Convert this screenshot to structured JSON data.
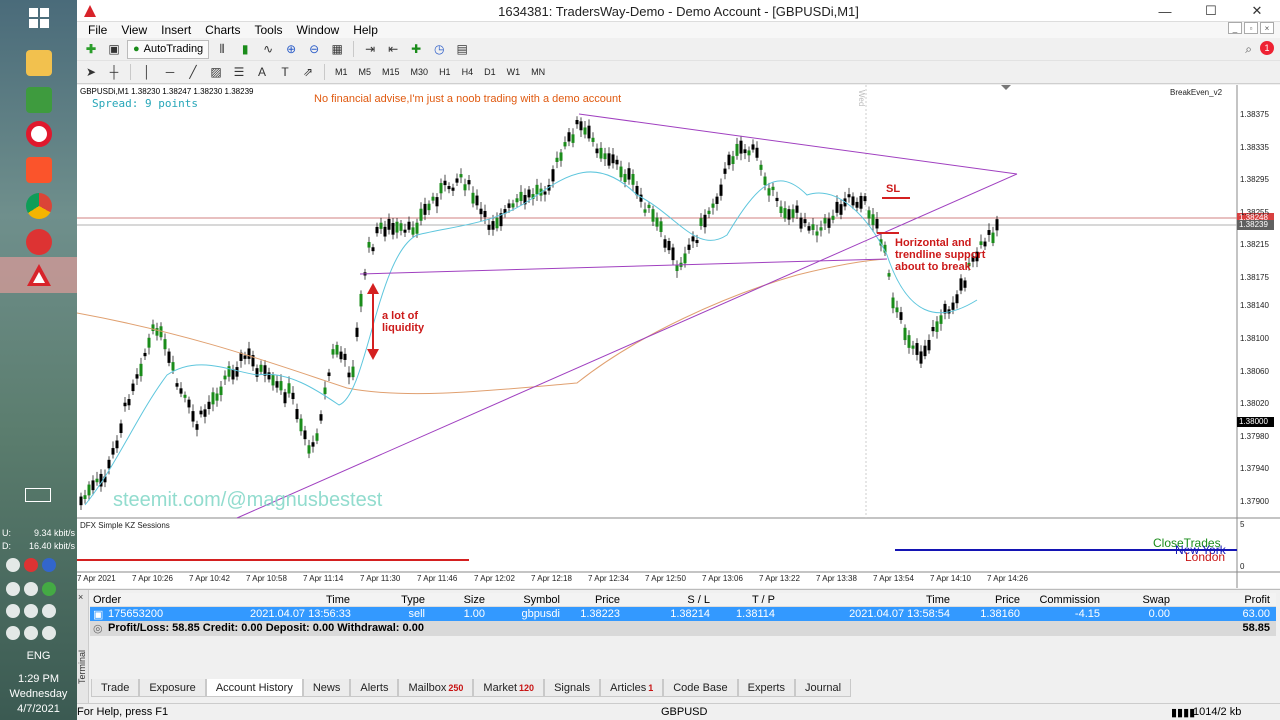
{
  "taskbar": {
    "net_upload": "9.34 kbit/s",
    "net_download": "16.40 kbit/s",
    "net_u": "U:",
    "net_d": "D:",
    "language": "ENG",
    "time": "1:29 PM",
    "day": "Wednesday",
    "date": "4/7/2021"
  },
  "window": {
    "title": "1634381: TradersWay-Demo - Demo Account - [GBPUSDi,M1]",
    "minimize": "—",
    "maximize": "☐",
    "close": "✕"
  },
  "menu": [
    "File",
    "View",
    "Insert",
    "Charts",
    "Tools",
    "Window",
    "Help"
  ],
  "toolbar": {
    "autotrading_label": "AutoTrading",
    "timeframes": [
      "M1",
      "M5",
      "M15",
      "M30",
      "H1",
      "H4",
      "D1",
      "W1",
      "MN"
    ],
    "notification_count": "1"
  },
  "chart": {
    "header": "GBPUSDi,M1  1.38230 1.38247 1.38230 1.38239",
    "spread": "Spread: 9 points",
    "advise": "No financial advise,I'm just a noob trading with a demo account",
    "indicator": "BreakEven_v2",
    "watermark": "steemit.com/@magnusbestest",
    "annotation_liquidity_1": "a lot of",
    "annotation_liquidity_2": "liquidity",
    "annotation_sl": "SL",
    "annotation_break_1": "Horizontal and",
    "annotation_break_2": "trendline support",
    "annotation_break_3": "about to break",
    "subwindow_title": "DFX Simple KZ Sessions",
    "sub_max": "5",
    "sub_min": "0",
    "closetrades": "CloseTrades",
    "newyork": "New York",
    "london": "London",
    "day_marker": "Wed",
    "price_levels": [
      "1.38375",
      "1.38335",
      "1.38295",
      "1.38255",
      "1.38215",
      "1.38175",
      "1.38140",
      "1.38100",
      "1.38060",
      "1.38020",
      "1.37980",
      "1.37940",
      "1.37900"
    ],
    "tag_bid": "1.38248",
    "tag_ask": "1.38239",
    "tag_level": "1.38000",
    "time_labels": [
      "7 Apr 2021",
      "7 Apr 10:26",
      "7 Apr 10:42",
      "7 Apr 10:58",
      "7 Apr 11:14",
      "7 Apr 11:30",
      "7 Apr 11:46",
      "7 Apr 12:02",
      "7 Apr 12:18",
      "7 Apr 12:34",
      "7 Apr 12:50",
      "7 Apr 13:06",
      "7 Apr 13:22",
      "7 Apr 13:38",
      "7 Apr 13:54",
      "7 Apr 14:10",
      "7 Apr 14:26"
    ]
  },
  "terminal": {
    "side_label": "Terminal",
    "close": "×",
    "columns": {
      "order": "Order",
      "time": "Time",
      "type": "Type",
      "size": "Size",
      "symbol": "Symbol",
      "price": "Price",
      "sl": "S / L",
      "tp": "T / P",
      "time2": "Time",
      "price2": "Price",
      "commission": "Commission",
      "swap": "Swap",
      "profit": "Profit"
    },
    "row": {
      "order": "175653200",
      "time": "2021.04.07 13:56:33",
      "type": "sell",
      "size": "1.00",
      "symbol": "gbpusdi",
      "price": "1.38223",
      "sl": "1.38214",
      "tp": "1.38114",
      "time2": "2021.04.07 13:58:54",
      "price2": "1.38160",
      "commission": "-4.15",
      "swap": "0.00",
      "profit": "63.00"
    },
    "summary": "Profit/Loss: 58.85  Credit: 0.00  Deposit: 0.00  Withdrawal: 0.00",
    "summary_total": "58.85",
    "tabs": [
      {
        "label": "Trade",
        "badge": ""
      },
      {
        "label": "Exposure",
        "badge": ""
      },
      {
        "label": "Account History",
        "badge": ""
      },
      {
        "label": "News",
        "badge": ""
      },
      {
        "label": "Alerts",
        "badge": ""
      },
      {
        "label": "Mailbox",
        "badge": "250"
      },
      {
        "label": "Market",
        "badge": "120"
      },
      {
        "label": "Signals",
        "badge": ""
      },
      {
        "label": "Articles",
        "badge": "1"
      },
      {
        "label": "Code Base",
        "badge": ""
      },
      {
        "label": "Experts",
        "badge": ""
      },
      {
        "label": "Journal",
        "badge": ""
      }
    ]
  },
  "status": {
    "help": "For Help, press F1",
    "symbol": "GBPUSD",
    "traffic": "1014/2 kb"
  },
  "colors": {
    "accent": "#3399ff",
    "bull": "#1a8c1a",
    "annotation": "#cc1a1a",
    "trendline": "#a040c0",
    "ma_fast": "#5ec6dd",
    "ma_slow": "#e0a070"
  }
}
